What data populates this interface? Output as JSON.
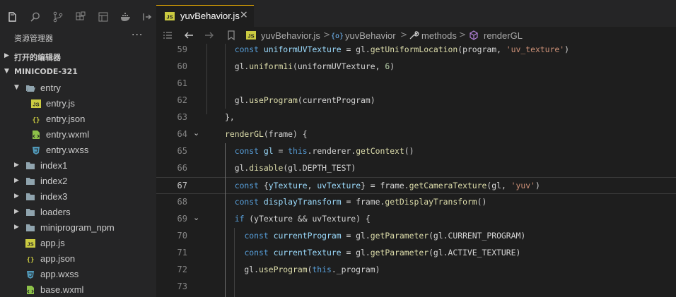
{
  "sidebar": {
    "title": "资源管理器",
    "more": "···",
    "activity_icons": [
      "explorer-icon",
      "search-icon",
      "source-control-icon",
      "extensions-icon",
      "layout-icon",
      "docker-icon",
      "remote-icon"
    ],
    "open_editors_label": "打开的编辑器",
    "project_label": "MINICODE-321",
    "tree": [
      {
        "name": "entry",
        "type": "folder-open",
        "depth": 1
      },
      {
        "name": "entry.js",
        "type": "js",
        "depth": 2
      },
      {
        "name": "entry.json",
        "type": "json",
        "depth": 2
      },
      {
        "name": "entry.wxml",
        "type": "wxml",
        "depth": 2
      },
      {
        "name": "entry.wxss",
        "type": "wxss",
        "depth": 2
      },
      {
        "name": "index1",
        "type": "folder",
        "depth": 1
      },
      {
        "name": "index2",
        "type": "folder",
        "depth": 1
      },
      {
        "name": "index3",
        "type": "folder",
        "depth": 1
      },
      {
        "name": "loaders",
        "type": "folder",
        "depth": 1
      },
      {
        "name": "miniprogram_npm",
        "type": "folder",
        "depth": 1
      },
      {
        "name": "app.js",
        "type": "js",
        "depth": 1
      },
      {
        "name": "app.json",
        "type": "json",
        "depth": 1
      },
      {
        "name": "app.wxss",
        "type": "wxss",
        "depth": 1
      },
      {
        "name": "base.wxml",
        "type": "wxml",
        "depth": 1
      }
    ]
  },
  "tab": {
    "label": "yuvBehavior.js",
    "close": "×",
    "icon_text": "JS"
  },
  "breadcrumb": {
    "file": "yuvBehavior.js",
    "object": "yuvBehavior",
    "methods": "methods",
    "method": "renderGL",
    "separator": ">"
  },
  "colors": {
    "accent": "#f0b000",
    "js": "#cbcb41",
    "json": "#cbcb41",
    "wxml": "#8dc149",
    "wxss": "#519aba",
    "folder": "#90a4ae"
  },
  "editor": {
    "current_line": 67,
    "lines": [
      {
        "n": "59",
        "code": [
          [
            "pn",
            "  "
          ],
          [
            "kw",
            "const "
          ],
          [
            "var",
            "uniformUVTexture"
          ],
          [
            "pn",
            " = gl."
          ],
          [
            "fn",
            "getUniformLocation"
          ],
          [
            "pn",
            "(program, "
          ],
          [
            "str",
            "'uv_texture'"
          ],
          [
            "pn",
            ")"
          ]
        ]
      },
      {
        "n": "60",
        "code": [
          [
            "pn",
            "  gl."
          ],
          [
            "fn",
            "uniform1i"
          ],
          [
            "pn",
            "(uniformUVTexture, "
          ],
          [
            "num",
            "6"
          ],
          [
            "pn",
            ")"
          ]
        ]
      },
      {
        "n": "61",
        "code": []
      },
      {
        "n": "62",
        "code": [
          [
            "pn",
            "  gl."
          ],
          [
            "fn",
            "useProgram"
          ],
          [
            "pn",
            "(currentProgram)"
          ]
        ]
      },
      {
        "n": "63",
        "code": [
          [
            "pn",
            "},"
          ]
        ]
      },
      {
        "n": "64",
        "code": [
          [
            "fn",
            "renderGL"
          ],
          [
            "pn",
            "(frame) {"
          ]
        ]
      },
      {
        "n": "65",
        "code": [
          [
            "pn",
            "  "
          ],
          [
            "kw",
            "const "
          ],
          [
            "var",
            "gl"
          ],
          [
            "pn",
            " = "
          ],
          [
            "kw",
            "this"
          ],
          [
            "pn",
            ".renderer."
          ],
          [
            "fn",
            "getContext"
          ],
          [
            "pn",
            "()"
          ]
        ]
      },
      {
        "n": "66",
        "code": [
          [
            "pn",
            "  gl."
          ],
          [
            "fn",
            "disable"
          ],
          [
            "pn",
            "(gl.DEPTH_TEST)"
          ]
        ]
      },
      {
        "n": "67",
        "code": [
          [
            "pn",
            "  "
          ],
          [
            "kw",
            "const "
          ],
          [
            "pn",
            "{"
          ],
          [
            "var",
            "yTexture"
          ],
          [
            "pn",
            ", "
          ],
          [
            "var",
            "uvTexture"
          ],
          [
            "pn",
            "} = frame."
          ],
          [
            "fn",
            "getCameraTexture"
          ],
          [
            "pn",
            "(gl, "
          ],
          [
            "str",
            "'yuv'"
          ],
          [
            "pn",
            ")"
          ]
        ]
      },
      {
        "n": "68",
        "code": [
          [
            "pn",
            "  "
          ],
          [
            "kw",
            "const "
          ],
          [
            "var",
            "displayTransform"
          ],
          [
            "pn",
            " = frame."
          ],
          [
            "fn",
            "getDisplayTransform"
          ],
          [
            "pn",
            "()"
          ]
        ]
      },
      {
        "n": "69",
        "code": [
          [
            "pn",
            "  "
          ],
          [
            "kw",
            "if "
          ],
          [
            "pn",
            "(yTexture && uvTexture) {"
          ]
        ]
      },
      {
        "n": "70",
        "code": [
          [
            "pn",
            "    "
          ],
          [
            "kw",
            "const "
          ],
          [
            "var",
            "currentProgram"
          ],
          [
            "pn",
            " = gl."
          ],
          [
            "fn",
            "getParameter"
          ],
          [
            "pn",
            "(gl.CURRENT_PROGRAM)"
          ]
        ]
      },
      {
        "n": "71",
        "code": [
          [
            "pn",
            "    "
          ],
          [
            "kw",
            "const "
          ],
          [
            "var",
            "currentTexture"
          ],
          [
            "pn",
            " = gl."
          ],
          [
            "fn",
            "getParameter"
          ],
          [
            "pn",
            "(gl.ACTIVE_TEXTURE)"
          ]
        ]
      },
      {
        "n": "72",
        "code": [
          [
            "pn",
            "    gl."
          ],
          [
            "fn",
            "useProgram"
          ],
          [
            "pn",
            "("
          ],
          [
            "kw",
            "this"
          ],
          [
            "pn",
            "._program)"
          ]
        ]
      },
      {
        "n": "73",
        "code": []
      }
    ]
  }
}
